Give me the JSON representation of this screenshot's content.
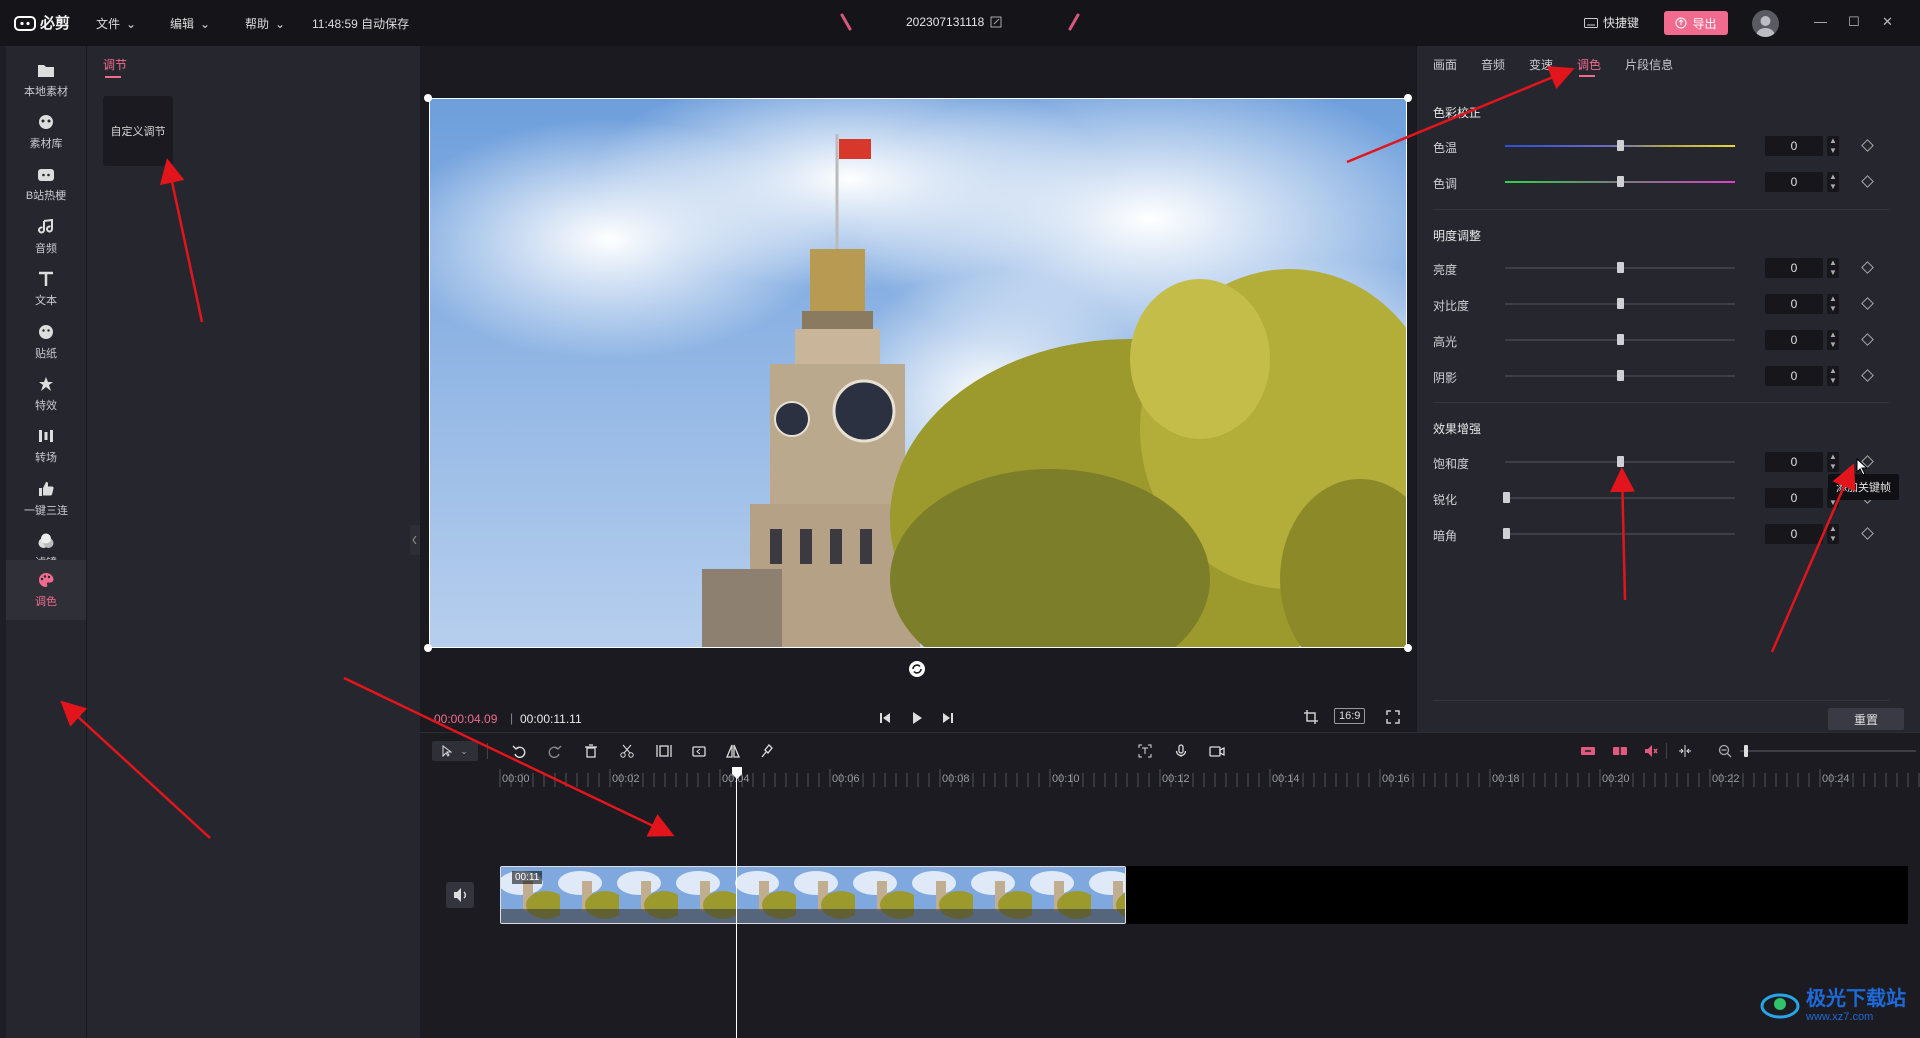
{
  "app": {
    "name": "必剪"
  },
  "menu": [
    {
      "label": "文件"
    },
    {
      "label": "编辑"
    },
    {
      "label": "帮助"
    }
  ],
  "autosave": "11:48:59 自动保存",
  "project_title": "202307131118",
  "shortcut_label": "快捷键",
  "export_label": "导出",
  "left_nav": [
    {
      "label": "本地素材",
      "icon": "folder-icon"
    },
    {
      "label": "素材库",
      "icon": "library-icon"
    },
    {
      "label": "B站热梗",
      "icon": "tv-icon"
    },
    {
      "label": "音频",
      "icon": "music-icon"
    },
    {
      "label": "文本",
      "icon": "text-icon"
    },
    {
      "label": "贴纸",
      "icon": "sticker-icon"
    },
    {
      "label": "特效",
      "icon": "effects-icon"
    },
    {
      "label": "转场",
      "icon": "transition-icon"
    },
    {
      "label": "一键三连",
      "icon": "thumbs-up-icon"
    },
    {
      "label": "滤镜",
      "icon": "filter-icon"
    },
    {
      "label": "调色",
      "icon": "palette-icon",
      "active": true
    }
  ],
  "adjust_panel": {
    "tab": "调节",
    "custom_label": "自定义调节"
  },
  "preview": {
    "current_time": "00:00:04.09",
    "separator": "|",
    "total_time": "00:00:11.11",
    "ratio": "16:9"
  },
  "right_tabs": [
    {
      "label": "画面"
    },
    {
      "label": "音频"
    },
    {
      "label": "变速"
    },
    {
      "label": "调色",
      "active": true
    },
    {
      "label": "片段信息"
    }
  ],
  "color_correction": {
    "title": "色彩校正",
    "rows": [
      {
        "label": "色温",
        "value": "0"
      },
      {
        "label": "色调",
        "value": "0"
      }
    ]
  },
  "brightness": {
    "title": "明度调整",
    "rows": [
      {
        "label": "亮度",
        "value": "0"
      },
      {
        "label": "对比度",
        "value": "0"
      },
      {
        "label": "高光",
        "value": "0"
      },
      {
        "label": "阴影",
        "value": "0"
      }
    ]
  },
  "effects": {
    "title": "效果增强",
    "rows": [
      {
        "label": "饱和度",
        "value": "0"
      },
      {
        "label": "锐化",
        "value": "0"
      },
      {
        "label": "暗角",
        "value": "0"
      }
    ]
  },
  "tooltip": "添加关键帧",
  "reset_label": "重置",
  "timeline": {
    "ticks": [
      "00:00",
      "00:02",
      "00:04",
      "00:06",
      "00:08",
      "00:10",
      "00:12",
      "00:14",
      "00:16",
      "00:18",
      "00:20",
      "00:22",
      "00:24"
    ],
    "clip_duration": "00:11"
  },
  "watermark": {
    "line1": "极光下载站",
    "line2": "www.xz7.com"
  },
  "colors": {
    "accent": "#f06b8e",
    "export": "#f26a8d",
    "bg": "#1e1e25"
  }
}
